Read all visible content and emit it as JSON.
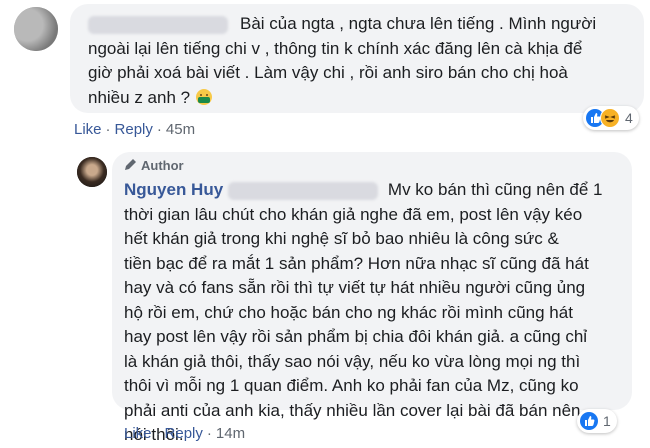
{
  "comment1": {
    "lines": [
      "Bài của ngta , ngta chưa lên tiếng . Mình người",
      "ngoài lại lên tiếng chi v , thông tin k chính xác đăng lên cà khịa để",
      "giờ phải xoá bài viết . Làm vậy chi , rồi anh siro bán cho chị hoà",
      "nhiều z anh ?"
    ],
    "like_label": "Like",
    "reply_label": "Reply",
    "time": "45m",
    "reaction_count": "4",
    "reactions": [
      "like-icon",
      "haha-icon"
    ]
  },
  "comment2": {
    "badge": "Author",
    "author_name": "Nguyen Huy",
    "first_line": "Mv ko bán thì cũng nên để 1",
    "lines": [
      "thời gian lâu chút cho khán giả nghe đã em, post lên vậy kéo",
      "hết khán giả trong khi nghệ sĩ bỏ bao nhiêu là công sức &",
      "tiền bạc để ra mắt 1 sản phẩm? Hơn nữa nhạc sĩ cũng đã hát",
      "hay và có fans sẵn rồi thì tự viết tự hát nhiều người cũng ủng",
      "hộ rồi em, chứ cho hoặc bán cho ng khác rồi mình cũng hát",
      "hay post lên vậy rồi sản phẩm bị chia đôi khán giả. a cũng chỉ",
      "là khán giả thôi, thấy sao nói vậy, nếu ko vừa lòng mọi ng thì",
      "thôi vì mỗi ng 1 quan điểm. Anh ko phải fan của Mz, cũng ko",
      "phải anti của anh kia, thấy nhiều lần cover lại bài đã bán nên",
      "nói thôi."
    ],
    "like_label": "Like",
    "reply_label": "Reply",
    "time": "14m",
    "reaction_count": "1",
    "reactions": [
      "like-icon"
    ]
  },
  "colors": {
    "link": "#385898",
    "bubble": "#f2f3f5",
    "meta": "#606770",
    "like": "#1877f2",
    "haha": "#f7b125"
  }
}
